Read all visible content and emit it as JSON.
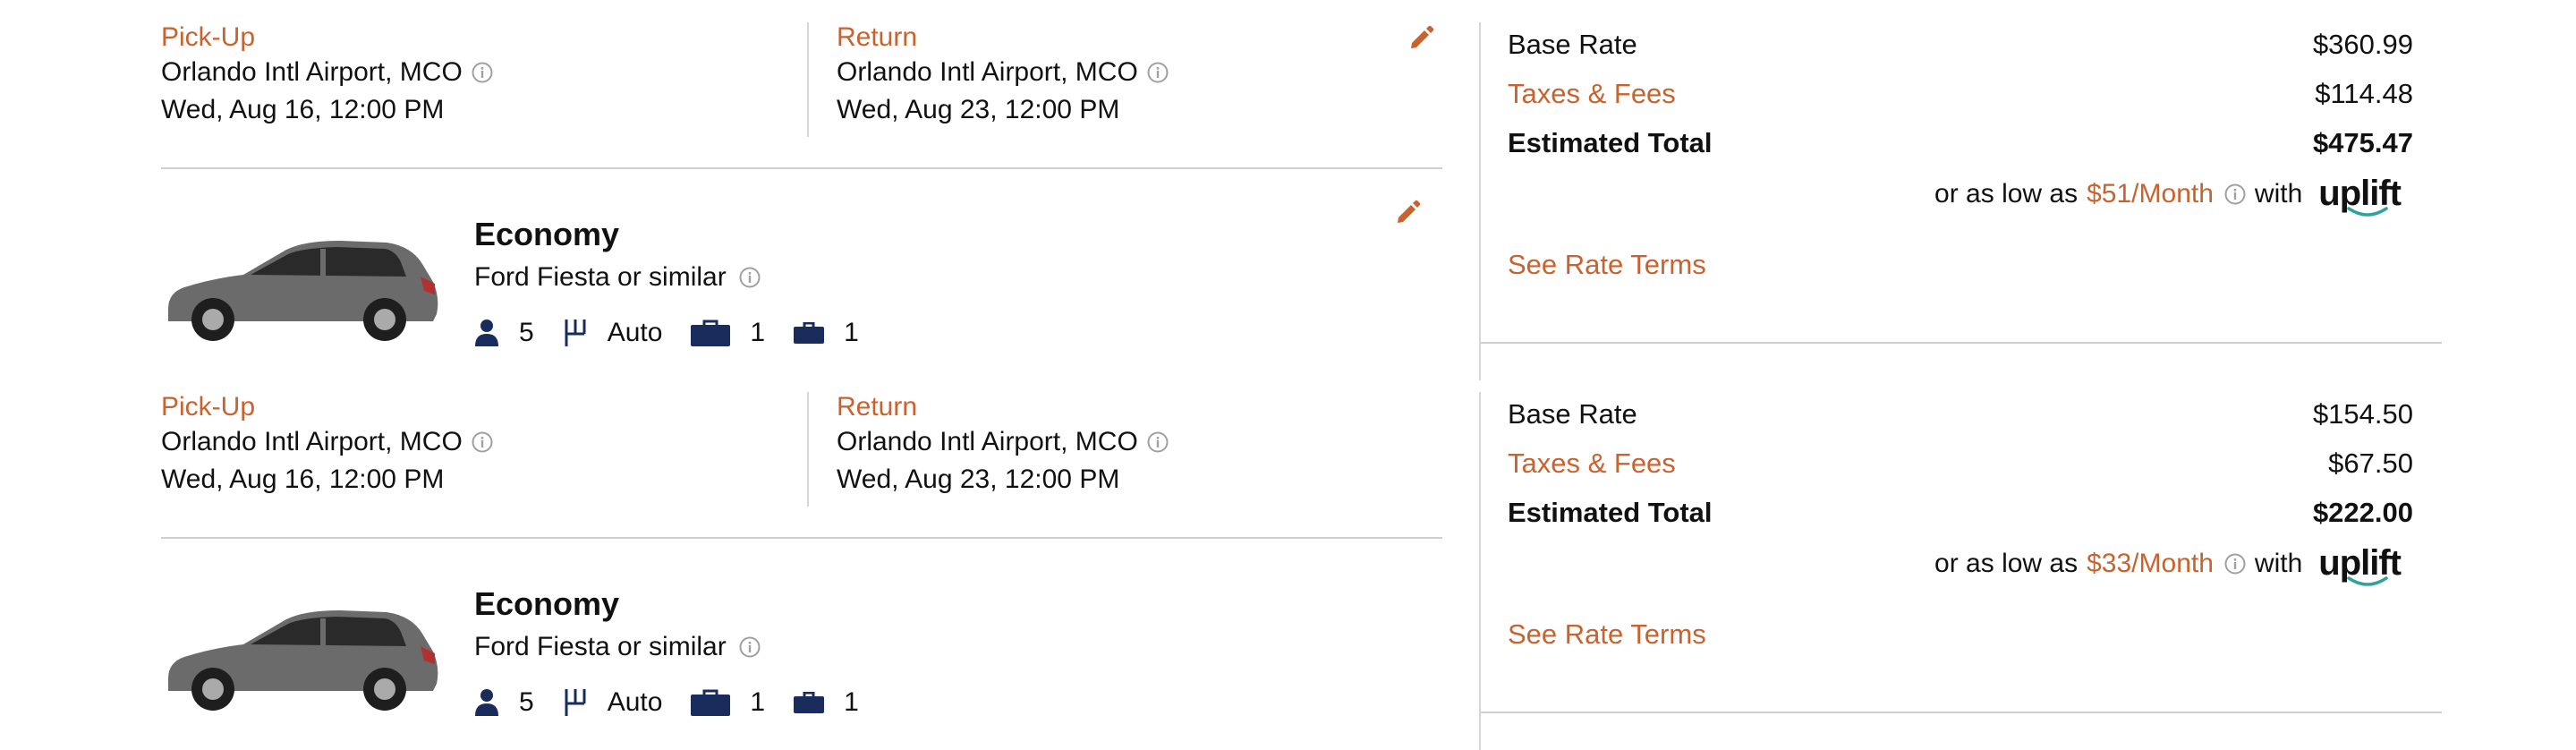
{
  "colors": {
    "accent": "#c8632f",
    "feature_icon": "#1a2c5b",
    "divider": "#cfcfcf",
    "info_icon": "#a0a0a0"
  },
  "reservations": [
    {
      "pickup": {
        "label": "Pick-Up",
        "location": "Orlando Intl Airport, MCO",
        "datetime": "Wed, Aug 16, 12:00 PM"
      },
      "return": {
        "label": "Return",
        "location": "Orlando Intl Airport, MCO",
        "datetime": "Wed, Aug 23, 12:00 PM"
      },
      "car": {
        "class": "Economy",
        "model": "Ford Fiesta or similar",
        "passengers": "5",
        "transmission": "Auto",
        "large_bags": "1",
        "small_bags": "1"
      },
      "pricing": {
        "base_rate_label": "Base Rate",
        "base_rate": "$360.99",
        "taxes_label": "Taxes & Fees",
        "taxes": "$114.48",
        "total_label": "Estimated Total",
        "total": "$475.47",
        "low_prefix": "or as low as",
        "monthly": "$51/Month",
        "with": "with",
        "uplift_logo": "uplift",
        "see_terms": "See Rate Terms"
      }
    },
    {
      "pickup": {
        "label": "Pick-Up",
        "location": "Orlando Intl Airport, MCO",
        "datetime": "Wed, Aug 16, 12:00 PM"
      },
      "return": {
        "label": "Return",
        "location": "Orlando Intl Airport, MCO",
        "datetime": "Wed, Aug 23, 12:00 PM"
      },
      "car": {
        "class": "Economy",
        "model": "Ford Fiesta or similar",
        "passengers": "5",
        "transmission": "Auto",
        "large_bags": "1",
        "small_bags": "1"
      },
      "pricing": {
        "base_rate_label": "Base Rate",
        "base_rate": "$154.50",
        "taxes_label": "Taxes & Fees",
        "taxes": "$67.50",
        "total_label": "Estimated Total",
        "total": "$222.00",
        "low_prefix": "or as low as",
        "monthly": "$33/Month",
        "with": "with",
        "uplift_logo": "uplift",
        "see_terms": "See Rate Terms"
      }
    }
  ]
}
